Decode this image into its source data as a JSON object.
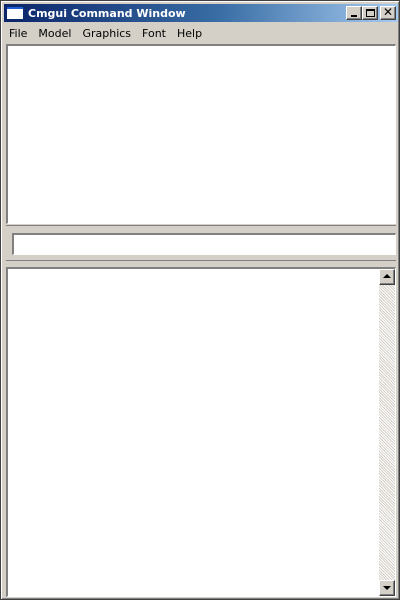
{
  "window": {
    "title": "Cmgui Command Window"
  },
  "menubar": {
    "items": [
      {
        "label": "File"
      },
      {
        "label": "Model"
      },
      {
        "label": "Graphics"
      },
      {
        "label": "Font"
      },
      {
        "label": "Help"
      }
    ]
  },
  "command": {
    "value": "",
    "placeholder": ""
  },
  "icons": {
    "app": "window-app-icon",
    "minimize": "minimize-icon",
    "maximize": "maximize-icon",
    "close": "close-icon",
    "scroll_up": "scroll-up-arrow-icon",
    "scroll_down": "scroll-down-arrow-icon"
  },
  "colors": {
    "titlebar_start": "#0a246a",
    "titlebar_end": "#a6caf0",
    "chrome": "#d4d0c8"
  }
}
